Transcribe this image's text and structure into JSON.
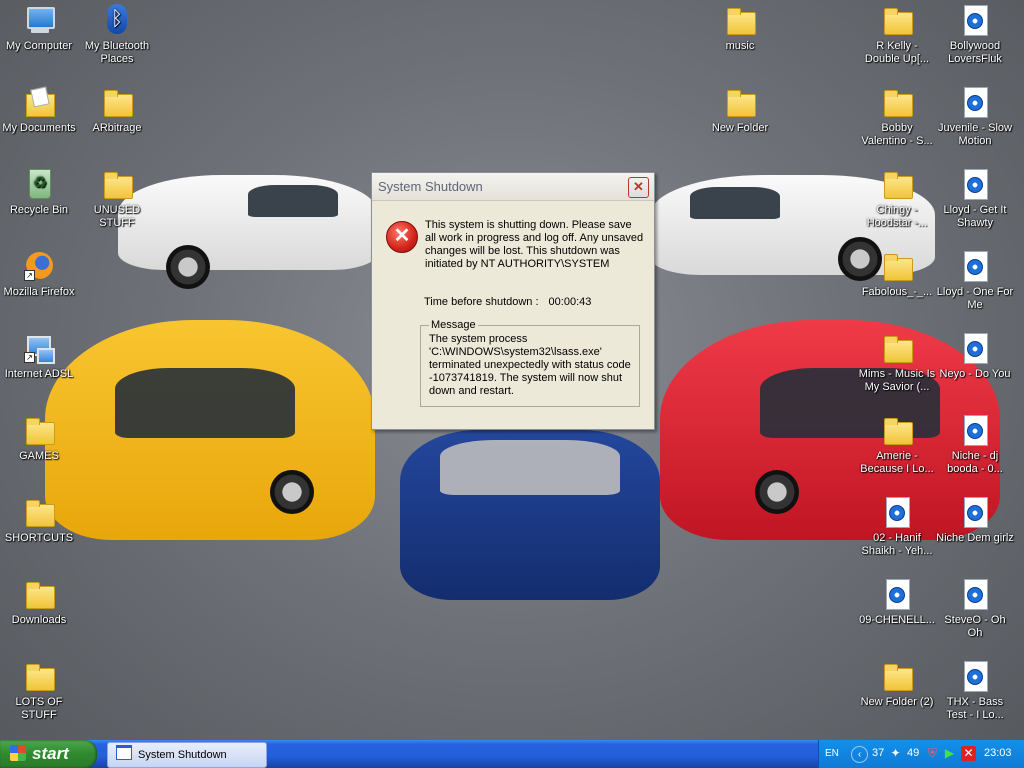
{
  "desktop": {
    "left_icons": [
      {
        "label": "My Computer",
        "icon": "computer-icon"
      },
      {
        "label": "My Documents",
        "icon": "documents-folder-icon"
      },
      {
        "label": "Recycle Bin",
        "icon": "recycle-bin-icon"
      },
      {
        "label": "Mozilla Firefox",
        "icon": "firefox-icon"
      },
      {
        "label": "Internet ADSL",
        "icon": "network-connection-icon"
      },
      {
        "label": "GAMES",
        "icon": "folder-icon"
      },
      {
        "label": "SHORTCUTS",
        "icon": "folder-icon"
      },
      {
        "label": "Downloads",
        "icon": "folder-icon"
      },
      {
        "label": "LOTS OF STUFF",
        "icon": "folder-icon"
      }
    ],
    "col2_icons": [
      {
        "label": "My Bluetooth Places",
        "icon": "bluetooth-icon"
      },
      {
        "label": "ARbitrage",
        "icon": "folder-icon"
      },
      {
        "label": "UNUSED STUFF",
        "icon": "folder-icon"
      }
    ],
    "mid_icons": [
      {
        "label": "music",
        "icon": "folder-icon"
      },
      {
        "label": "New Folder",
        "icon": "folder-icon"
      }
    ],
    "col4_icons": [
      {
        "label": "R Kelly - Double Up[...",
        "icon": "folder-icon"
      },
      {
        "label": "Bobby Valentino - S...",
        "icon": "folder-icon"
      },
      {
        "label": "Chingy - Hoodstar -...",
        "icon": "folder-icon"
      },
      {
        "label": "Fabolous_-_...",
        "icon": "folder-icon"
      },
      {
        "label": "Mims - Music Is My Savior (...",
        "icon": "folder-icon"
      },
      {
        "label": "Amerie - Because I Lo...",
        "icon": "folder-icon"
      },
      {
        "label": "02 - Hanif Shaikh - Yeh...",
        "icon": "media-file-icon"
      },
      {
        "label": "09-CHENELL...",
        "icon": "media-file-icon"
      },
      {
        "label": "New Folder (2)",
        "icon": "folder-icon"
      }
    ],
    "col5_icons": [
      {
        "label": "Bollywood LoversFluk",
        "icon": "media-file-icon"
      },
      {
        "label": "Juvenile - Slow Motion",
        "icon": "media-file-icon"
      },
      {
        "label": "Lloyd - Get It Shawty",
        "icon": "media-file-icon"
      },
      {
        "label": "Lloyd - One For Me",
        "icon": "media-file-icon"
      },
      {
        "label": "Neyo - Do You",
        "icon": "media-file-icon"
      },
      {
        "label": "Niche - dj booda - 0...",
        "icon": "media-file-icon"
      },
      {
        "label": "Niche Dem girlz",
        "icon": "media-file-icon"
      },
      {
        "label": "SteveO - Oh Oh",
        "icon": "media-file-icon"
      },
      {
        "label": "THX - Bass Test - I Lo...",
        "icon": "media-file-icon"
      }
    ]
  },
  "dialog": {
    "title": "System Shutdown",
    "close_glyph": "✕",
    "message": "This system is shutting down. Please save all work in progress and log off. Any unsaved changes will be lost. This shutdown was initiated by NT AUTHORITY\\SYSTEM",
    "time_label": "Time before shutdown :",
    "time_value": "00:00:43",
    "group_label": "Message",
    "group_text": "The system process 'C:\\WINDOWS\\system32\\lsass.exe' terminated unexpectedly with status code -1073741819.  The system will now shut down and restart."
  },
  "taskbar": {
    "start_label": "start",
    "task_button": "System Shutdown",
    "tray": {
      "lang": "EN",
      "count_a": "37",
      "count_b": "49",
      "clock": "23:03"
    }
  },
  "colors": {
    "taskbar": "#245edb",
    "start_green": "#2f8a2f",
    "dialog_bg": "#ece9d8",
    "error_red": "#d2231a"
  }
}
